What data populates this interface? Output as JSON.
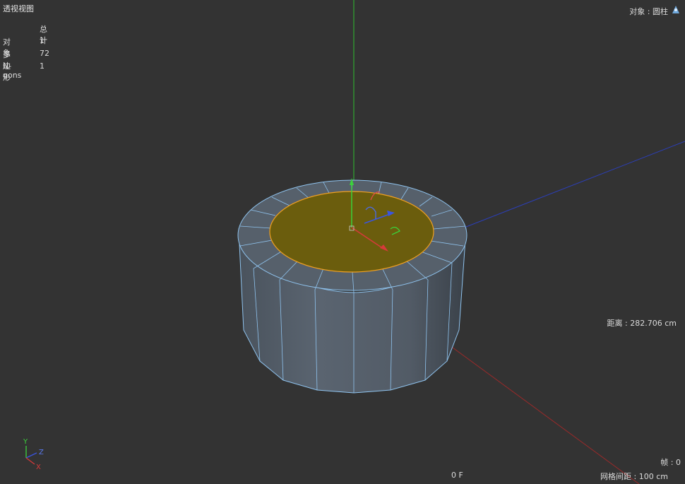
{
  "viewport": {
    "title": "透视视图",
    "stats": {
      "header": "总计",
      "rows": [
        {
          "label": "对象",
          "value": "1"
        },
        {
          "label": "多边形",
          "value": "72"
        },
        {
          "label": "N-gons",
          "value": "1"
        }
      ]
    },
    "object_label": "对象 : 圆柱",
    "distance_label": "距离 : 282.706 cm",
    "frame_label": "帧 : 0",
    "grid_spacing_label": "网格间距 : 100 cm",
    "time_label": "0 F",
    "axis_labels": {
      "y": "Y",
      "z": "Z",
      "x": "X"
    }
  },
  "colors": {
    "background": "#333333",
    "selected_face": "#6b5d0d",
    "selection_outline": "#f0a020",
    "cylinder_body": "#56606b",
    "wire": "#8fc3ee",
    "axis_x": "#d63a3a",
    "axis_y": "#3bd23b",
    "axis_z": "#3a55e0"
  }
}
